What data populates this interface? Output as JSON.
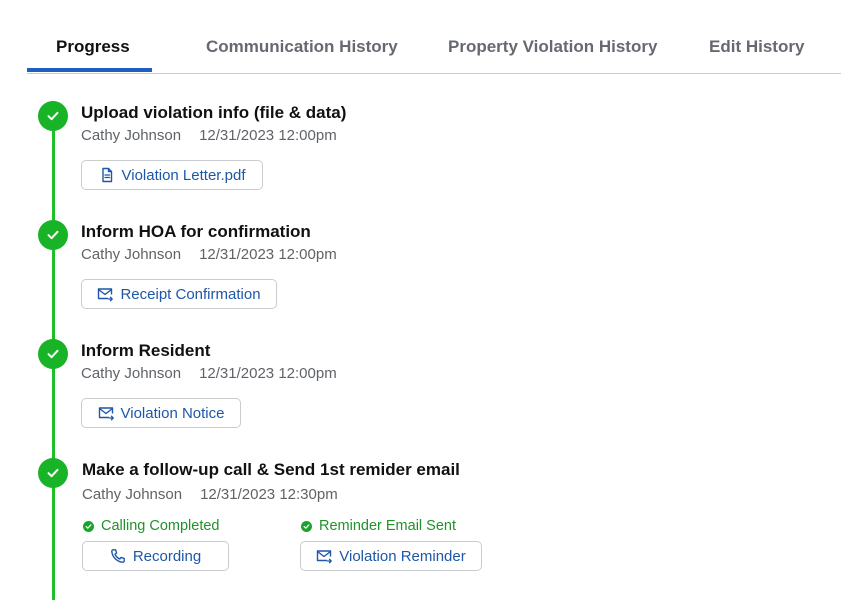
{
  "tabs": [
    {
      "label": "Progress",
      "active": true
    },
    {
      "label": "Communication History",
      "active": false
    },
    {
      "label": "Property Violation History",
      "active": false
    },
    {
      "label": "Edit History",
      "active": false
    }
  ],
  "colors": {
    "accent": "#1f5fc2",
    "success": "#19b328",
    "link": "#1d57a8"
  },
  "steps": [
    {
      "title": "Upload violation info (file & data)",
      "user": "Cathy Johnson",
      "datetime": "12/31/2023 12:00pm",
      "buttons": [
        {
          "label": "Violation Letter.pdf",
          "icon": "document-icon"
        }
      ]
    },
    {
      "title": "Inform HOA for confirmation",
      "user": "Cathy Johnson",
      "datetime": "12/31/2023 12:00pm",
      "buttons": [
        {
          "label": "Receipt Confirmation",
          "icon": "mail-send-icon"
        }
      ]
    },
    {
      "title": "Inform Resident",
      "user": "Cathy Johnson",
      "datetime": "12/31/2023 12:00pm",
      "buttons": [
        {
          "label": "Violation Notice",
          "icon": "mail-send-icon"
        }
      ]
    },
    {
      "title": "Make a follow-up call & Send 1st remider email",
      "user": "Cathy Johnson",
      "datetime": "12/31/2023 12:30pm",
      "statuses": [
        "Calling Completed",
        "Reminder Email Sent"
      ],
      "buttons": [
        {
          "label": "Recording",
          "icon": "phone-icon"
        },
        {
          "label": "Violation Reminder",
          "icon": "mail-send-icon"
        }
      ]
    }
  ]
}
